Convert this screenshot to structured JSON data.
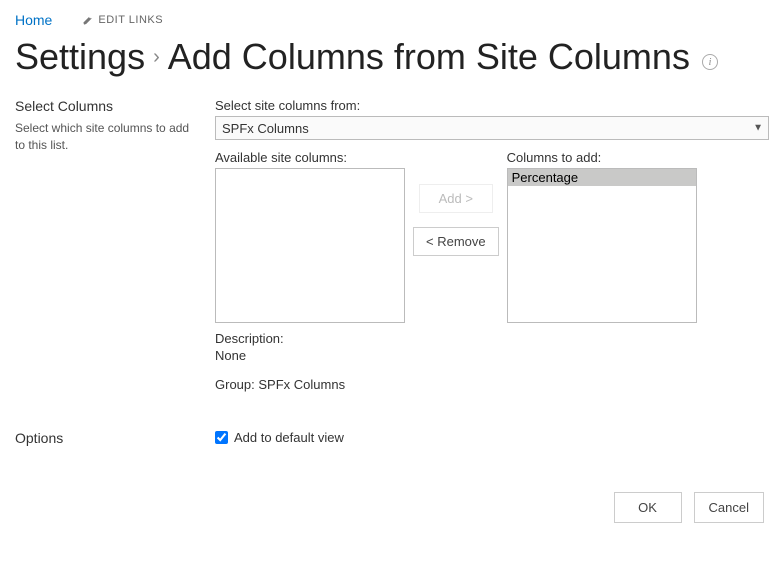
{
  "nav": {
    "home": "Home",
    "edit_links": "EDIT LINKS"
  },
  "title": {
    "settings": "Settings",
    "page": "Add Columns from Site Columns"
  },
  "select_columns": {
    "heading": "Select Columns",
    "desc": "Select which site columns to add to this list.",
    "select_from_label": "Select site columns from:",
    "selected_group": "SPFx Columns",
    "available_label": "Available site columns:",
    "to_add_label": "Columns to add:",
    "add_btn": "Add >",
    "remove_btn": "< Remove",
    "columns_to_add": [
      "Percentage"
    ],
    "description_label": "Description:",
    "description_value": "None",
    "group_label": "Group:",
    "group_value": "SPFx Columns"
  },
  "options": {
    "heading": "Options",
    "add_default_view": "Add to default view",
    "add_default_view_checked": true
  },
  "footer": {
    "ok": "OK",
    "cancel": "Cancel"
  }
}
